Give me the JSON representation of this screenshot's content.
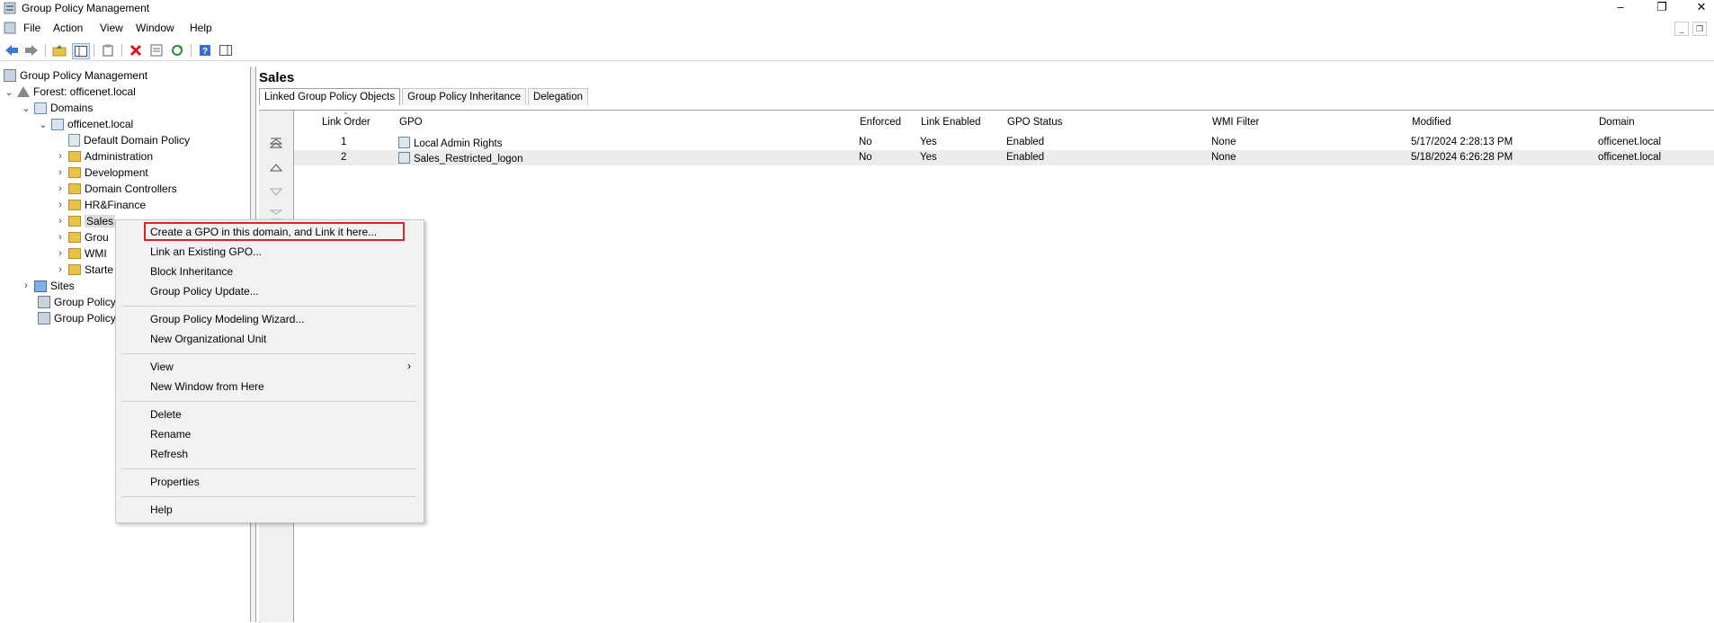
{
  "window": {
    "title": "Group Policy Management"
  },
  "menu": [
    "File",
    "Action",
    "View",
    "Window",
    "Help"
  ],
  "tree": {
    "root": "Group Policy Management",
    "forest": "Forest: officenet.local",
    "domains": "Domains",
    "domain": "officenet.local",
    "children": [
      "Default Domain Policy",
      "Administration",
      "Development",
      "Domain Controllers",
      "HR&Finance",
      "Sales",
      "Grou",
      "WMI",
      "Starte"
    ],
    "sites": "Sites",
    "modeling": "Group Policy",
    "results": "Group Policy"
  },
  "pane": {
    "title": "Sales",
    "tabs": [
      "Linked Group Policy Objects",
      "Group Policy Inheritance",
      "Delegation"
    ],
    "columns": [
      "Link Order",
      "GPO",
      "Enforced",
      "Link Enabled",
      "GPO Status",
      "WMI Filter",
      "Modified",
      "Domain"
    ],
    "rows": [
      {
        "order": "1",
        "gpo": "Local Admin Rights",
        "enforced": "No",
        "link_enabled": "Yes",
        "status": "Enabled",
        "wmi": "None",
        "modified": "5/17/2024 2:28:13 PM",
        "domain": "officenet.local"
      },
      {
        "order": "2",
        "gpo": "Sales_Restricted_logon",
        "enforced": "No",
        "link_enabled": "Yes",
        "status": "Enabled",
        "wmi": "None",
        "modified": "5/18/2024 6:26:28 PM",
        "domain": "officenet.local"
      }
    ]
  },
  "context_menu": {
    "items": [
      "Create a GPO in this domain, and Link it here...",
      "Link an Existing GPO...",
      "Block Inheritance",
      "Group Policy Update...",
      "Group Policy Modeling Wizard...",
      "New Organizational Unit",
      "View",
      "New Window from Here",
      "Delete",
      "Rename",
      "Refresh",
      "Properties",
      "Help"
    ],
    "highlight_color": "#e0202a"
  },
  "icons": [
    "back-icon",
    "forward-icon",
    "up-folder-icon",
    "show-tree-icon",
    "clipboard-icon",
    "delete-icon",
    "properties-icon",
    "refresh-icon",
    "help-icon",
    "panel-icon"
  ]
}
